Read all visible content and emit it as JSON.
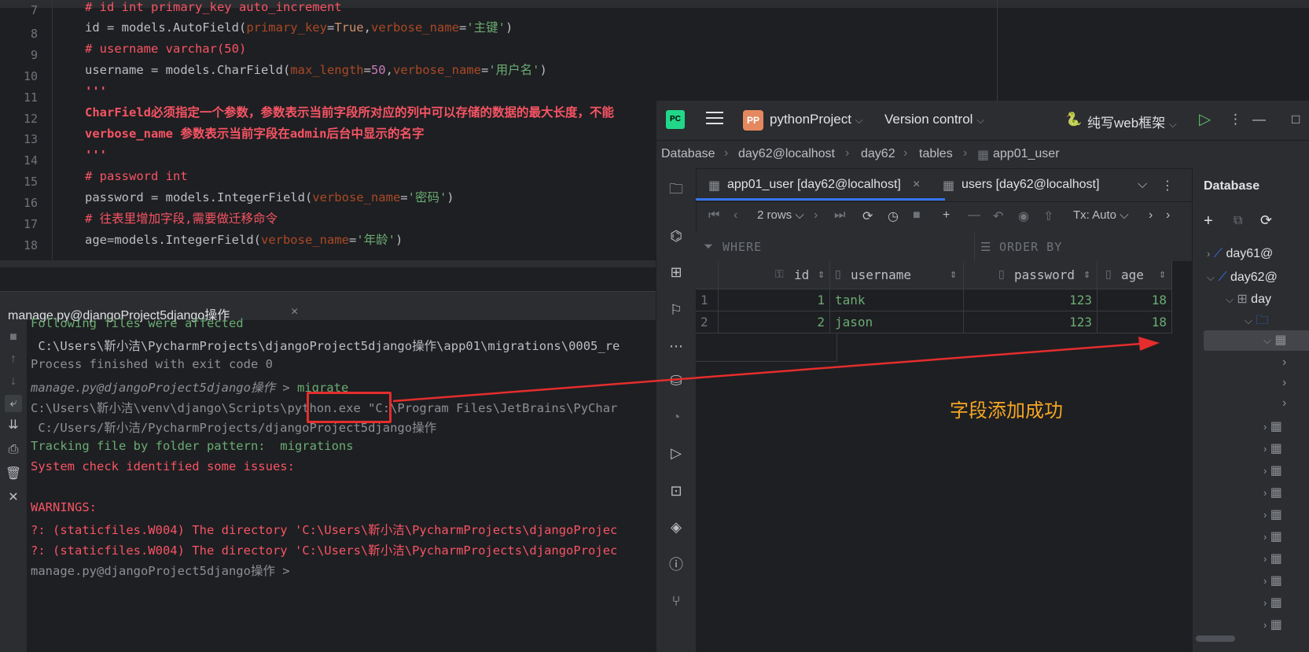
{
  "editor": {
    "line_numbers": [
      "7",
      "8",
      "9",
      "10",
      "11",
      "12",
      "13",
      "14",
      "15",
      "16",
      "17",
      "18"
    ],
    "lines": {
      "l7": "# id int primary_key auto_increment",
      "l8_a": "id = models.AutoField(",
      "l8_b": "primary_key",
      "l8_c": "=",
      "l8_d": "True",
      "l8_e": ",",
      "l8_f": "verbose_name",
      "l8_g": "=",
      "l8_h": "'主键'",
      "l8_i": ")",
      "l9": "# username varchar(50)",
      "l10_a": "username = models.CharField(",
      "l10_b": "max_length",
      "l10_c": "=",
      "l10_d": "50",
      "l10_e": ",",
      "l10_f": "verbose_name",
      "l10_g": "=",
      "l10_h": "'用户名'",
      "l10_i": ")",
      "l11": "'''",
      "l12": "CharField必须指定一个参数，参数表示当前字段所对应的列中可以存储的数据的最大长度，不能",
      "l13": "verbose_name 参数表示当前字段在admin后台中显示的名字",
      "l14": "'''",
      "l15": "# password int",
      "l16_a": "password = models.IntegerField(",
      "l16_b": "verbose_name",
      "l16_c": "=",
      "l16_d": "'密码'",
      "l16_e": ")",
      "l17": "# 往表里增加字段,需要做迁移命令",
      "l18_a": "age",
      "l18_b": "=",
      "l18_c": "models.IntegerField(",
      "l18_d": "verbose_name",
      "l18_e": "=",
      "l18_f": "'年龄'",
      "l18_g": ")"
    }
  },
  "terminal": {
    "title": "manage.py@djangoProject5django操作",
    "close": "×",
    "lines": {
      "t1": "Following files were affected",
      "t2": " C:\\Users\\靳小洁\\PycharmProjects\\djangoProject5django操作\\app01\\migrations\\0005_re",
      "t3": "Process finished with exit code 0",
      "t4_prompt": "manage.py@djangoProject5django操作 > ",
      "t4_cmd": "migrate",
      "t5": "C:\\Users\\靳小洁\\venv\\django\\Scripts\\python.exe \"C:\\Program Files\\JetBrains\\PyChar",
      "t6": " C:/Users/靳小洁/PycharmProjects/djangoProject5django操作",
      "t7": "Tracking file by folder pattern:  migrations",
      "t8": "System check identified some issues:",
      "t9": "WARNINGS:",
      "t10": "?: (staticfiles.W004) The directory 'C:\\Users\\靳小洁\\PycharmProjects\\djangoProjec",
      "t11": "?: (staticfiles.W004) The directory 'C:\\Users\\靳小洁\\PycharmProjects\\djangoProjec",
      "t12": "manage.py@djangoProject5django操作 > "
    }
  },
  "db_window": {
    "logo": "PC",
    "project_badge": "PP",
    "project": "pythonProject",
    "vcs": "Version control",
    "run_config": "纯写web框架",
    "breadcrumb": [
      "Database",
      "day62@localhost",
      "day62",
      "tables",
      "app01_user"
    ],
    "tabs": [
      "app01_user [day62@localhost]",
      "users [day62@localhost]"
    ],
    "rows_label": "2 rows",
    "tx_label": "Tx: Auto",
    "where": "WHERE",
    "order_by": "ORDER BY",
    "columns": [
      "id",
      "username",
      "password",
      "age"
    ],
    "rows": [
      {
        "n": "1",
        "id": "1",
        "username": "tank",
        "password": "123",
        "age": "18"
      },
      {
        "n": "2",
        "id": "2",
        "username": "jason",
        "password": "123",
        "age": "18"
      }
    ],
    "panel_title": "Database",
    "tree": [
      "day61@",
      "day62@",
      "day"
    ]
  },
  "annotation": "字段添加成功",
  "colors": {
    "accent": "#3574f0",
    "annotation": "#f5a623",
    "highlight": "#e52d2d"
  }
}
